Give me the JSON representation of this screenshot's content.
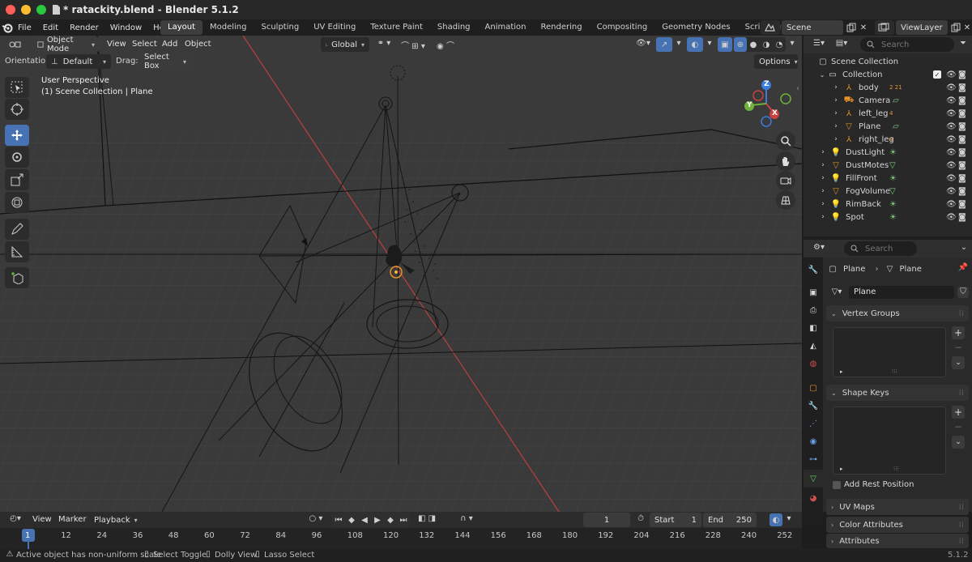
{
  "window": {
    "title": "* ratackity.blend - Blender 5.1.2"
  },
  "menu": [
    "File",
    "Edit",
    "Render",
    "Window",
    "Help"
  ],
  "workspaces": [
    "Layout",
    "Modeling",
    "Sculpting",
    "UV Editing",
    "Texture Paint",
    "Shading",
    "Animation",
    "Rendering",
    "Compositing",
    "Geometry Nodes",
    "Scripting"
  ],
  "active_workspace": "Layout",
  "scene": {
    "name": "Scene",
    "view_layer": "ViewLayer"
  },
  "viewport": {
    "mode": "Object Mode",
    "menus": [
      "View",
      "Select",
      "Add",
      "Object"
    ],
    "transform_orientation": "Global",
    "options_label": "Options",
    "orientation_label": "Orientation:",
    "orientation_value": "Default",
    "drag_label": "Drag:",
    "drag_value": "Select Box",
    "overlay_line1": "User Perspective",
    "overlay_line2": "(1) Scene Collection | Plane",
    "gizmo_axes": {
      "x": "X",
      "y": "Y",
      "z": "Z"
    }
  },
  "outliner": {
    "search_placeholder": "Search",
    "root": "Scene Collection",
    "collection": "Collection",
    "children": [
      {
        "name": "body",
        "badge": "2   21"
      },
      {
        "name": "Camera",
        "badge": ""
      },
      {
        "name": "left_leg",
        "badge": "4"
      },
      {
        "name": "Plane",
        "badge": ""
      },
      {
        "name": "right_leg",
        "badge": "4"
      }
    ],
    "objects": [
      "DustLight",
      "DustMotes",
      "FillFront",
      "FogVolume",
      "RimBack",
      "Spot"
    ]
  },
  "properties": {
    "search_placeholder": "Search",
    "breadcrumb_object": "Plane",
    "breadcrumb_data": "Plane",
    "mesh_name": "Plane",
    "vertex_groups": "Vertex Groups",
    "shape_keys": "Shape Keys",
    "add_rest_position": "Add Rest Position",
    "uv_maps": "UV Maps",
    "color_attributes": "Color Attributes",
    "attributes": "Attributes"
  },
  "timeline": {
    "menus": [
      "View",
      "Marker"
    ],
    "playback": "Playback",
    "current_frame": "1",
    "start_label": "Start",
    "start": "1",
    "end_label": "End",
    "end": "250",
    "ruler": [
      "1",
      "12",
      "24",
      "36",
      "48",
      "60",
      "72",
      "84",
      "96",
      "108",
      "120",
      "132",
      "144",
      "156",
      "168",
      "180",
      "192",
      "204",
      "216",
      "228",
      "240",
      "252"
    ]
  },
  "status": {
    "warning": "Active object has non-uniform scale",
    "hint1": "Select Toggle",
    "hint2": "Dolly View",
    "hint3": "Lasso Select",
    "version": "5.1.2"
  },
  "colors": {
    "accent": "#4772b3",
    "selected_row": "#334d80",
    "x_axis": "#c94242",
    "y_axis": "#6fb33b",
    "z_axis": "#3d7be0",
    "object_orange": "#e8922c"
  }
}
